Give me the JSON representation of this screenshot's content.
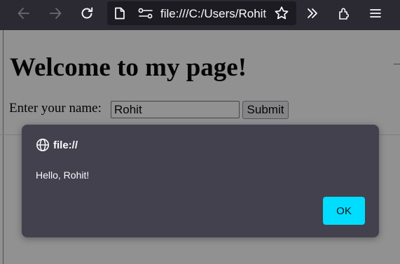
{
  "browser": {
    "url": "file:///C:/Users/Rohit",
    "icons": {
      "back": "back-arrow-icon",
      "forward": "forward-arrow-icon",
      "reload": "reload-icon",
      "page": "page-icon",
      "permissions": "permissions-icon",
      "bookmark": "star-icon",
      "overflow": "chevron-double-right-icon",
      "extensions": "extensions-icon",
      "menu": "hamburger-menu-icon"
    }
  },
  "page": {
    "heading": "Welcome to my page!",
    "name_label": "Enter your name:",
    "name_value": "Rohit",
    "submit_label": "Submit"
  },
  "dialog": {
    "origin": "file://",
    "message": "Hello, Rohit!",
    "ok_label": "OK",
    "accent_color": "#00ddff",
    "background_color": "#42414d"
  }
}
